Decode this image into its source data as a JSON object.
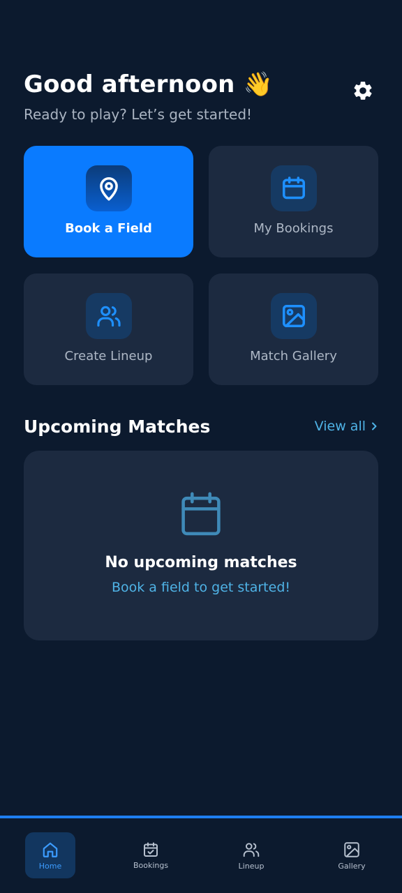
{
  "header": {
    "greeting": "Good afternoon 👋",
    "subtitle": "Ready to play? Let’s get started!"
  },
  "settings": {
    "icon": "gear-icon"
  },
  "quick_actions": [
    {
      "label": "Book a Field",
      "icon": "map-pin-icon",
      "selected": true
    },
    {
      "label": "My Bookings",
      "icon": "calendar-icon",
      "selected": false
    },
    {
      "label": "Create Lineup",
      "icon": "users-icon",
      "selected": false
    },
    {
      "label": "Match Gallery",
      "icon": "image-icon",
      "selected": false
    }
  ],
  "upcoming": {
    "title": "Upcoming Matches",
    "view_all": "View all",
    "empty_title": "No upcoming matches",
    "empty_cta": "Book a field to get started!"
  },
  "bottom_nav": {
    "items": [
      {
        "label": "Home",
        "icon": "home-icon",
        "active": true
      },
      {
        "label": "Bookings",
        "icon": "calendar-check-icon",
        "active": false
      },
      {
        "label": "Lineup",
        "icon": "users-icon",
        "active": false
      },
      {
        "label": "Gallery",
        "icon": "image-icon",
        "active": false
      }
    ]
  },
  "colors": {
    "background": "#0c1a2e",
    "card": "#1c2a40",
    "primary": "#0a7bff",
    "accent_text": "#4fb3e6",
    "nav_border": "#1e7ef0"
  }
}
